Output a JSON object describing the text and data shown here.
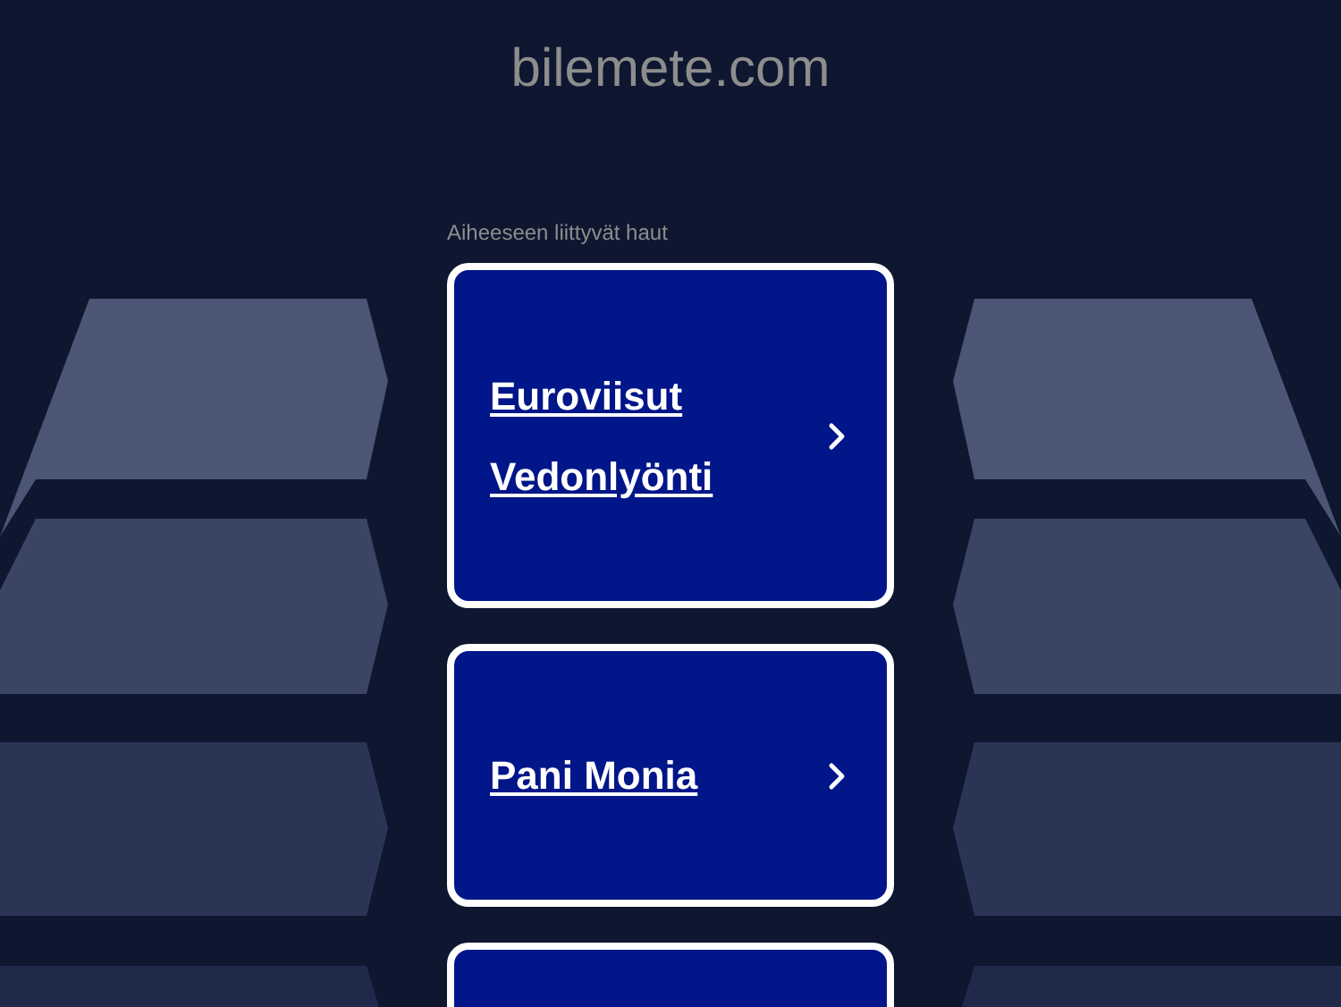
{
  "site_title": "bilemete.com",
  "section_heading": "Aiheeseen liittyvät haut",
  "cards": [
    {
      "kind": "link",
      "label": "Euroviisut Vedonlyönti"
    },
    {
      "kind": "link",
      "label": "Pani Monia"
    },
    {
      "kind": "cut"
    }
  ]
}
